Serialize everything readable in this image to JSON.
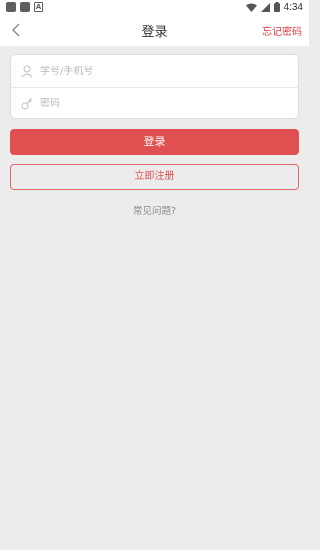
{
  "status_bar": {
    "time": "4:34"
  },
  "nav": {
    "title": "登录",
    "forgot_label": "忘记密码"
  },
  "form": {
    "username_placeholder": "学号/手机号",
    "password_placeholder": "密码"
  },
  "actions": {
    "login_label": "登录",
    "register_label": "立即注册",
    "faq_label": "常见问题?"
  },
  "colors": {
    "accent": "#e05050",
    "background": "#ececec"
  }
}
